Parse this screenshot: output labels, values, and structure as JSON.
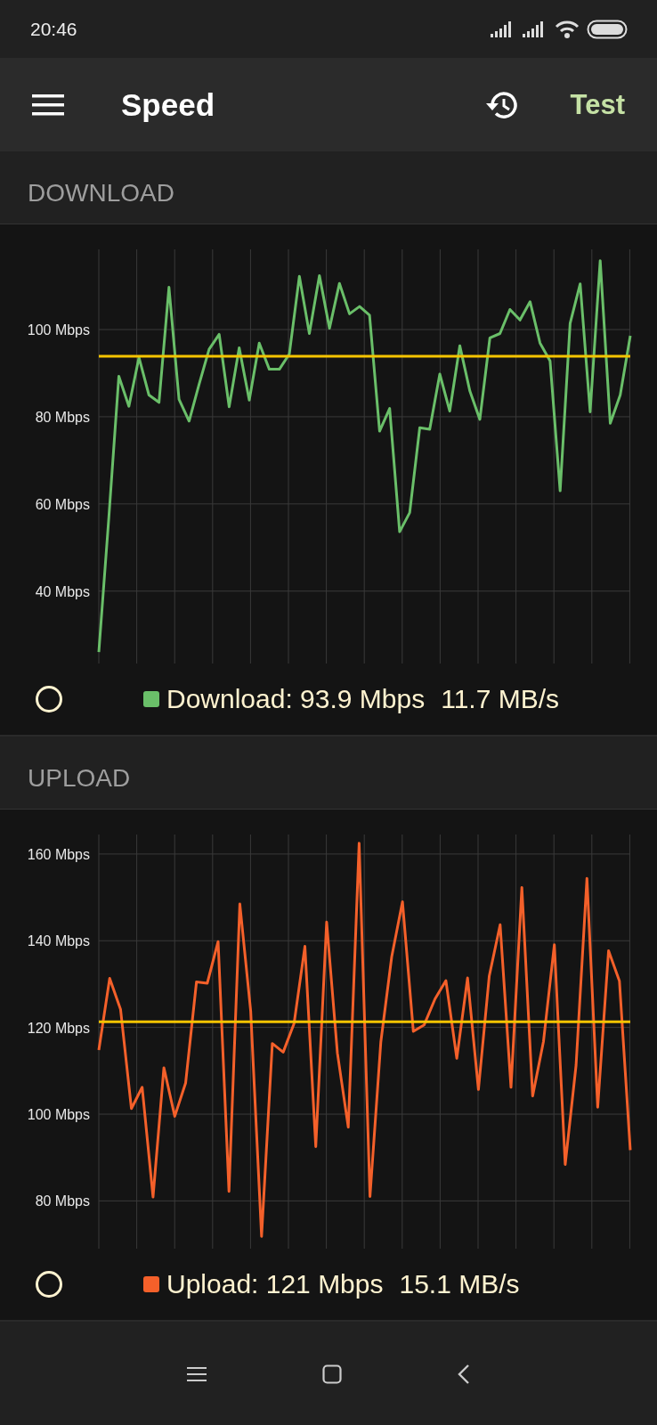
{
  "status_bar": {
    "time": "20:46"
  },
  "app_bar": {
    "title": "Speed",
    "action": "Test"
  },
  "sections": [
    {
      "heading": "DOWNLOAD",
      "chart_data": {
        "type": "line",
        "categories": [
          null,
          null,
          null,
          null,
          null,
          null,
          null,
          null,
          null,
          null,
          null,
          null,
          null,
          null,
          null,
          null,
          null,
          null,
          null,
          null,
          null,
          null,
          null,
          null,
          null,
          null,
          null,
          null,
          null,
          null,
          null,
          null,
          null,
          null,
          null,
          null,
          null,
          null,
          null,
          null,
          null,
          null,
          null,
          null,
          null,
          null,
          null,
          null,
          null,
          null,
          null,
          null,
          null,
          null
        ],
        "series": [
          {
            "color": "#6abf69",
            "values": [
              26,
              57,
              89.3,
              82.4,
              93.6,
              85,
              83.3,
              109.7,
              84,
              79,
              87.4,
              95.5,
              98.9,
              82.3,
              95.8,
              83.8,
              96.9,
              90.9,
              90.9,
              94.4,
              112.2,
              99.1,
              112.4,
              100.3,
              110.6,
              103.6,
              105.3,
              103.3,
              76.7,
              81.9,
              53.6,
              58,
              77.5,
              77.1,
              89.8,
              81.3,
              96.3,
              85.9,
              79.4,
              98.1,
              99.1,
              104.6,
              102.2,
              106.4,
              96.9,
              92.8,
              63,
              101.4,
              110.5,
              81.1,
              115.8,
              78.5,
              85,
              98.6
            ]
          }
        ],
        "ylim": [
          24,
          118.4
        ],
        "grid": true,
        "yticks": [
          {
            "value": 40,
            "label": "40 Mbps"
          },
          {
            "value": 60,
            "label": "60 Mbps"
          },
          {
            "value": 80,
            "label": "80 Mbps"
          },
          {
            "value": 100,
            "label": "100 Mbps"
          }
        ],
        "ref_lines": [
          {
            "axis": "y",
            "value": 93.9,
            "color": "#f5c400"
          }
        ]
      },
      "legend": {
        "label": "Download: 93.9 Mbps",
        "rate": "11.7 MB/s"
      }
    },
    {
      "heading": "UPLOAD",
      "chart_data": {
        "type": "line",
        "categories": [
          null,
          null,
          null,
          null,
          null,
          null,
          null,
          null,
          null,
          null,
          null,
          null,
          null,
          null,
          null,
          null,
          null,
          null,
          null,
          null,
          null,
          null,
          null,
          null,
          null,
          null,
          null,
          null,
          null,
          null,
          null,
          null,
          null,
          null,
          null,
          null,
          null,
          null,
          null,
          null,
          null,
          null,
          null,
          null,
          null,
          null,
          null,
          null,
          null,
          null
        ],
        "series": [
          {
            "color": "#f4602a",
            "values": [
              114.8,
              131.3,
              124.2,
              101.3,
              106.2,
              80.9,
              110.7,
              99.5,
              107.2,
              130.5,
              130.2,
              139.8,
              82.2,
              148.5,
              123.8,
              71.8,
              116.3,
              114.3,
              120.9,
              138.7,
              92.5,
              144.3,
              114.1,
              97,
              162.5,
              81,
              116.7,
              136.3,
              149,
              119.1,
              120.6,
              126.6,
              130.8,
              112.9,
              131.4,
              105.7,
              131.9,
              143.7,
              106.2,
              152.3,
              104.2,
              116.8,
              139.1,
              88.4,
              111.3,
              154.4,
              101.6,
              137.7,
              130.7,
              91.7
            ]
          }
        ],
        "ylim": [
          69.6,
          164.5
        ],
        "grid": true,
        "yticks": [
          {
            "value": 80,
            "label": "80 Mbps"
          },
          {
            "value": 100,
            "label": "100 Mbps"
          },
          {
            "value": 120,
            "label": "120 Mbps"
          },
          {
            "value": 140,
            "label": "140 Mbps"
          },
          {
            "value": 160,
            "label": "160 Mbps"
          }
        ],
        "ref_lines": [
          {
            "axis": "y",
            "value": 121.3,
            "color": "#f5c400"
          }
        ]
      },
      "legend": {
        "label": "Upload: 121 Mbps",
        "rate": "15.1 MB/s"
      }
    }
  ]
}
